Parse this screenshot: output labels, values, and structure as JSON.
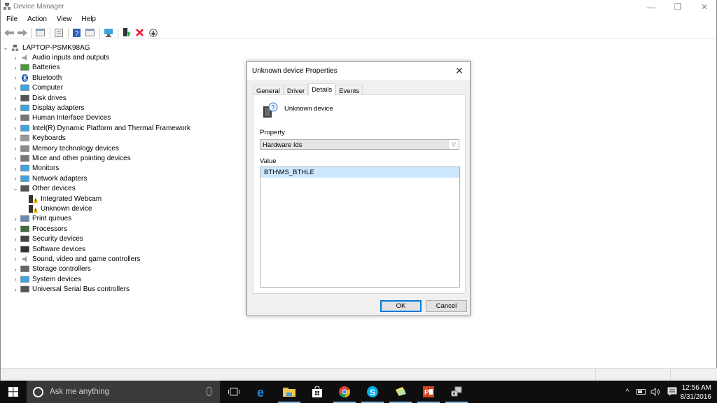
{
  "window": {
    "title": "Device Manager",
    "controls": {
      "minimize": "—",
      "restore": "❐",
      "close": "✕"
    }
  },
  "menubar": [
    "File",
    "Action",
    "View",
    "Help"
  ],
  "toolbar": [
    "back-icon",
    "forward-icon",
    "show-hide-console-tree-icon",
    "properties-icon",
    "help-icon",
    "action-pane-icon",
    "scan-hardware-icon",
    "update-driver-icon",
    "uninstall-icon",
    "disable-device-icon"
  ],
  "tree": {
    "root": "LAPTOP-PSMK98AG",
    "items": [
      {
        "label": "Audio inputs and outputs",
        "icon": "speaker-icon",
        "expanded": false
      },
      {
        "label": "Batteries",
        "icon": "battery-icon",
        "expanded": false
      },
      {
        "label": "Bluetooth",
        "icon": "bluetooth-icon",
        "expanded": false
      },
      {
        "label": "Computer",
        "icon": "computer-icon",
        "expanded": false
      },
      {
        "label": "Disk drives",
        "icon": "disk-drive-icon",
        "expanded": false
      },
      {
        "label": "Display adapters",
        "icon": "display-adapter-icon",
        "expanded": false
      },
      {
        "label": "Human Interface Devices",
        "icon": "hid-icon",
        "expanded": false
      },
      {
        "label": "Intel(R) Dynamic Platform and Thermal Framework",
        "icon": "system-icon",
        "expanded": false
      },
      {
        "label": "Keyboards",
        "icon": "keyboard-icon",
        "expanded": false
      },
      {
        "label": "Memory technology devices",
        "icon": "memory-icon",
        "expanded": false
      },
      {
        "label": "Mice and other pointing devices",
        "icon": "mouse-icon",
        "expanded": false
      },
      {
        "label": "Monitors",
        "icon": "monitor-icon",
        "expanded": false
      },
      {
        "label": "Network adapters",
        "icon": "network-icon",
        "expanded": false
      },
      {
        "label": "Other devices",
        "icon": "unknown-device-icon",
        "expanded": true
      },
      {
        "label": "Integrated Webcam",
        "icon": "warning-device-icon",
        "child": true
      },
      {
        "label": "Unknown device",
        "icon": "warning-device-icon",
        "child": true
      },
      {
        "label": "Print queues",
        "icon": "printer-icon",
        "expanded": false
      },
      {
        "label": "Processors",
        "icon": "processor-icon",
        "expanded": false
      },
      {
        "label": "Security devices",
        "icon": "security-icon",
        "expanded": false
      },
      {
        "label": "Software devices",
        "icon": "software-device-icon",
        "expanded": false
      },
      {
        "label": "Sound, video and game controllers",
        "icon": "speaker-icon",
        "expanded": false
      },
      {
        "label": "Storage controllers",
        "icon": "storage-icon",
        "expanded": false
      },
      {
        "label": "System devices",
        "icon": "system-icon",
        "expanded": false
      },
      {
        "label": "Universal Serial Bus controllers",
        "icon": "usb-icon",
        "expanded": false
      }
    ]
  },
  "dialog": {
    "title": "Unknown device Properties",
    "tabs": [
      {
        "label": "General",
        "active": false
      },
      {
        "label": "Driver",
        "active": false
      },
      {
        "label": "Details",
        "active": true
      },
      {
        "label": "Events",
        "active": false
      }
    ],
    "device_name": "Unknown device",
    "property_label": "Property",
    "property_value": "Hardware Ids",
    "value_label": "Value",
    "values": [
      "BTH\\MS_BTHLE"
    ],
    "ok_label": "OK",
    "cancel_label": "Cancel"
  },
  "taskbar": {
    "search_placeholder": "Ask me anything",
    "apps": [
      "task-view-icon",
      "edge-icon",
      "file-explorer-icon",
      "store-icon",
      "chrome-icon",
      "skype-icon",
      "sticky-notes-icon",
      "powerpoint-icon",
      "device-manager-icon"
    ],
    "time": "12:56 AM",
    "date": "8/31/2016"
  },
  "colors": {
    "accent": "#0078d7",
    "selection": "#cce8ff",
    "taskbar": "#0e0e0e",
    "search_box": "#3a3a3a"
  }
}
